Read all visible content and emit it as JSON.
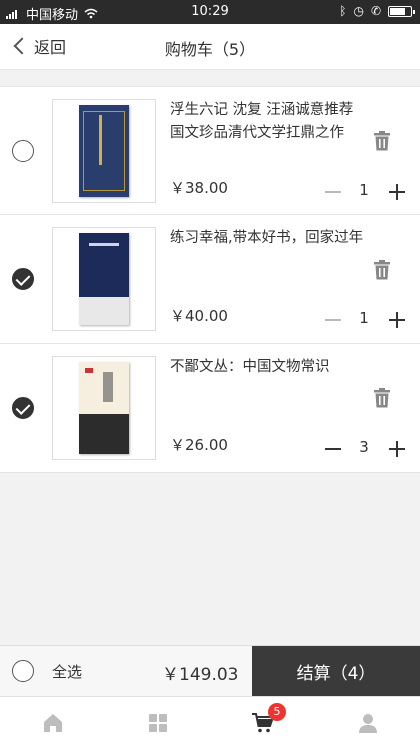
{
  "status_bar": {
    "carrier": "中国移动",
    "time": "10:29",
    "icons": [
      "signal-icon",
      "wifi-icon",
      "bluetooth-icon",
      "alarm-icon",
      "call-icon",
      "battery-icon"
    ]
  },
  "nav": {
    "back_label": "返回",
    "title": "购物车（5）"
  },
  "items": [
    {
      "title": "浮生六记 沈复 汪涵诚意推荐 国文珍品清代文学扛鼎之作",
      "price": "￥38.00",
      "quantity": "1",
      "checked": false
    },
    {
      "title": "练习幸福,带本好书，回家过年",
      "price": "￥40.00",
      "quantity": "1",
      "checked": true
    },
    {
      "title": "不鄙文丛：中国文物常识",
      "price": "￥26.00",
      "quantity": "3",
      "checked": true
    }
  ],
  "footer": {
    "select_all_label": "全选",
    "total": "￥149.03",
    "checkout_label": "结算（4）"
  },
  "tabbar": {
    "tabs": [
      "home-icon",
      "category-icon",
      "cart-icon",
      "profile-icon"
    ],
    "cart_badge": "5",
    "accent": "#e33333"
  }
}
